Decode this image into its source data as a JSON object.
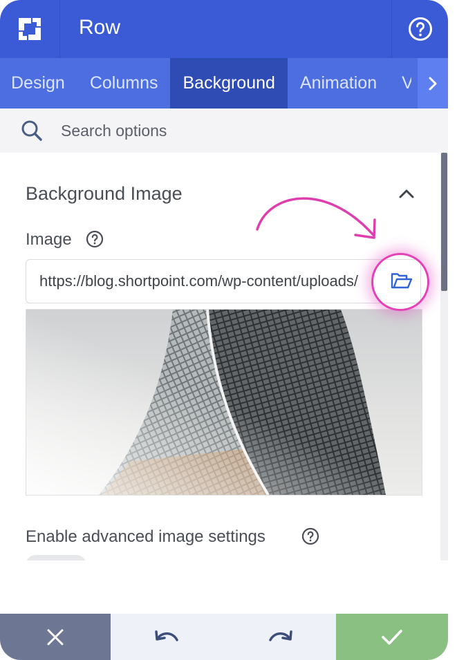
{
  "header": {
    "title": "Row",
    "logo_icon": "shortpoint-logo-icon",
    "help_icon": "help-circle-icon"
  },
  "tabs": [
    {
      "label": "Design",
      "active": false
    },
    {
      "label": "Columns",
      "active": false
    },
    {
      "label": "Background",
      "active": true
    },
    {
      "label": "Animation",
      "active": false
    },
    {
      "label": "V",
      "active": false
    }
  ],
  "search": {
    "placeholder": "Search options"
  },
  "section": {
    "title": "Background Image",
    "image_label": "Image",
    "image_url": "https://blog.shortpoint.com/wp-content/uploads/",
    "advanced_label": "Enable advanced image settings",
    "toggle_on": false
  },
  "colors": {
    "header": "#3b5bd6",
    "tab_bar": "#4d6ee0",
    "tab_active": "#2f4bb4",
    "cancel": "#6d7793",
    "save": "#8ac082",
    "highlight": "#e541b6"
  },
  "footer": {
    "cancel_icon": "close-icon",
    "undo_icon": "undo-icon",
    "redo_icon": "redo-icon",
    "save_icon": "check-icon"
  }
}
